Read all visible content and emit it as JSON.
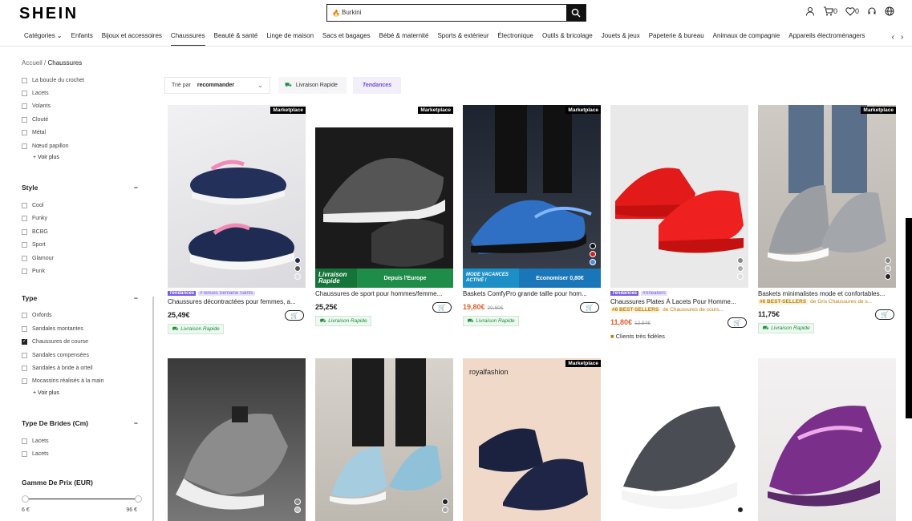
{
  "header": {
    "logo": "SHEIN",
    "search_value": "Burkini",
    "cart_count": "0",
    "wishlist_count": "0"
  },
  "nav": [
    "Catégories",
    "Enfants",
    "Bijoux et accessoires",
    "Chaussures",
    "Beauté & santé",
    "Linge de maison",
    "Sacs et bagages",
    "Bébé & maternité",
    "Sports & extérieur",
    "Électronique",
    "Outils & bricolage",
    "Jouets & jeux",
    "Papeterie & bureau",
    "Animaux de compagnie",
    "Appareils électroménagers"
  ],
  "breadcrumb": {
    "home": "Accueil",
    "sep": "/",
    "current": "Chaussures"
  },
  "sidebar": {
    "closure_options": [
      "La boucle du crochet",
      "Lacets",
      "Volants",
      "Clouté",
      "Métal",
      "Nœud papillon"
    ],
    "see_more": "+ Voir plus",
    "style_title": "Style",
    "style_options": [
      "Cool",
      "Funky",
      "BCBG",
      "Sport",
      "Glamour",
      "Punk"
    ],
    "type_title": "Type",
    "type_options": [
      "Oxfords",
      "Sandales montantes",
      "Chaussures de course",
      "Sandales compensées",
      "Sandales à bride à orteil",
      "Mocassins réalisés à la main"
    ],
    "strap_title": "Type De Brides (Cm)",
    "strap_options": [
      "Lacets",
      "Lacets"
    ],
    "price_title": "Gamme De Prix (EUR)",
    "price_min": "6 €",
    "price_max": "96 €",
    "collapse": "−"
  },
  "filters": {
    "sort_label": "Trié par",
    "sort_value": "recommander",
    "fast_delivery": "Livraison Rapide",
    "trends": "Tendances"
  },
  "badges": {
    "marketplace": "Marketplace",
    "tendances": "Tendances",
    "best_sellers": "#6 BEST-SELLERS",
    "fast": "Livraison Rapide"
  },
  "products": [
    {
      "name": "Chaussures décontractées pour femmes, a...",
      "price": "25,49€",
      "trend_tag": "#Tenues Semaine Saints",
      "marketplace": true
    },
    {
      "name": "Chaussures de sport pour hommes/femme...",
      "price": "25,25€",
      "marketplace": true,
      "banner_left": "Livraison Rapide",
      "banner_right": "Depuis l'Europe"
    },
    {
      "name": "Baskets ComfyPro grande taille pour hom...",
      "price": "19,80€",
      "old_price": "20,60€",
      "marketplace": true,
      "banner_left": "MODE VACANCES ACTIVÉ !",
      "banner_right": "Economiser 0,80€"
    },
    {
      "name": "Chaussures Plates À Lacets Pour Homme...",
      "price": "11,80€",
      "old_price": "12,54€",
      "trend_tag": "#Sneakers",
      "best_cat": "de Chaussures de cours...",
      "loyal": "Clients très fidèles"
    },
    {
      "name": "Baskets minimalistes mode et confortables...",
      "price": "11,75€",
      "marketplace": true,
      "best_cat": "de Gris Chaussures de s..."
    },
    {
      "name": "",
      "marketplace": false
    },
    {
      "name": "",
      "marketplace": false
    },
    {
      "name": "",
      "brand": "royalfashion",
      "marketplace": true
    },
    {
      "name": "",
      "marketplace": false
    },
    {
      "name": "",
      "marketplace": false
    }
  ]
}
